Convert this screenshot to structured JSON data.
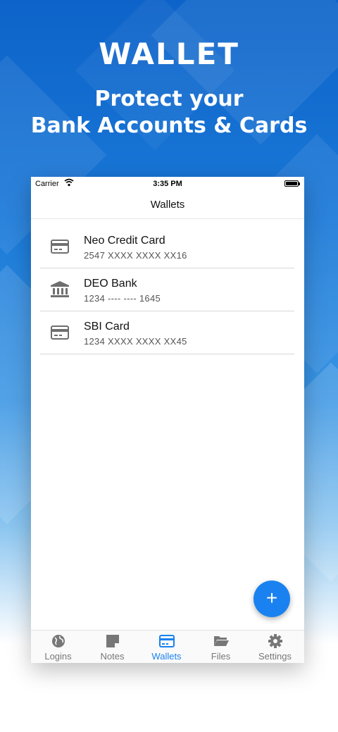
{
  "promo": {
    "title": "WALLET",
    "subtitle_line1": "Protect your",
    "subtitle_line2": "Bank Accounts & Cards"
  },
  "statusbar": {
    "carrier": "Carrier",
    "time": "3:35 PM"
  },
  "navbar": {
    "title": "Wallets"
  },
  "wallets": [
    {
      "name": "Neo Credit Card",
      "number": "2547 XXXX XXXX XX16",
      "icon": "credit-card-icon"
    },
    {
      "name": "DEO Bank",
      "number": "1234 ---- ---- 1645",
      "icon": "bank-icon"
    },
    {
      "name": "SBI Card",
      "number": "1234 XXXX XXXX XX45",
      "icon": "credit-card-icon"
    }
  ],
  "fab": {
    "label": "+",
    "icon": "add-icon"
  },
  "tabs": [
    {
      "label": "Logins",
      "icon": "globe-icon"
    },
    {
      "label": "Notes",
      "icon": "note-icon"
    },
    {
      "label": "Wallets",
      "icon": "credit-card-icon",
      "active": true
    },
    {
      "label": "Files",
      "icon": "folder-icon"
    },
    {
      "label": "Settings",
      "icon": "gear-icon"
    }
  ],
  "colors": {
    "accent": "#1a82f0",
    "background_top": "#0d63c9",
    "icon_gray": "#6f6f6f"
  }
}
